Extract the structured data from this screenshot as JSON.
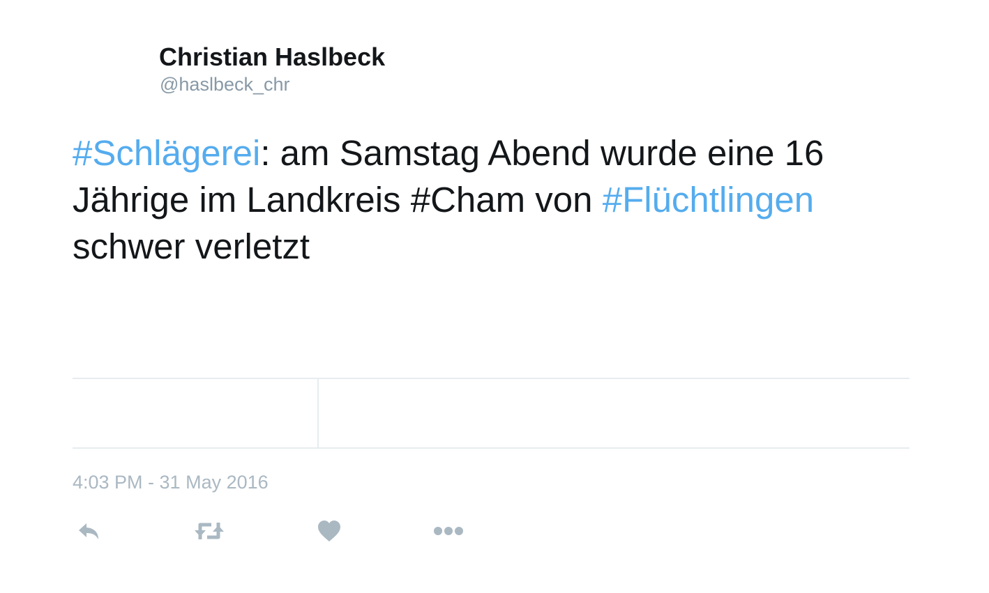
{
  "author": {
    "display_name": "Christian Haslbeck",
    "handle": "@haslbeck_chr"
  },
  "tweet": {
    "segments": {
      "s1": "#Schlägerei",
      "s2": ": am Samstag Abend wurde eine 16 Jährige im Landkreis ",
      "s3": "#Cham",
      "s4": " von ",
      "s5": "#Flüchtlingen",
      "s6": " schwer verletzt"
    },
    "timestamp": "4:03 PM - 31 May 2016"
  },
  "actions": {
    "reply_icon": "reply-icon",
    "retweet_icon": "retweet-icon",
    "like_icon": "heart-icon",
    "more_icon": "more-dots-icon"
  },
  "colors": {
    "hashtag_link": "#55acee",
    "text": "#14171a",
    "muted": "#8899a6",
    "icon": "#aab8c2",
    "divider": "#e6ecf0"
  }
}
